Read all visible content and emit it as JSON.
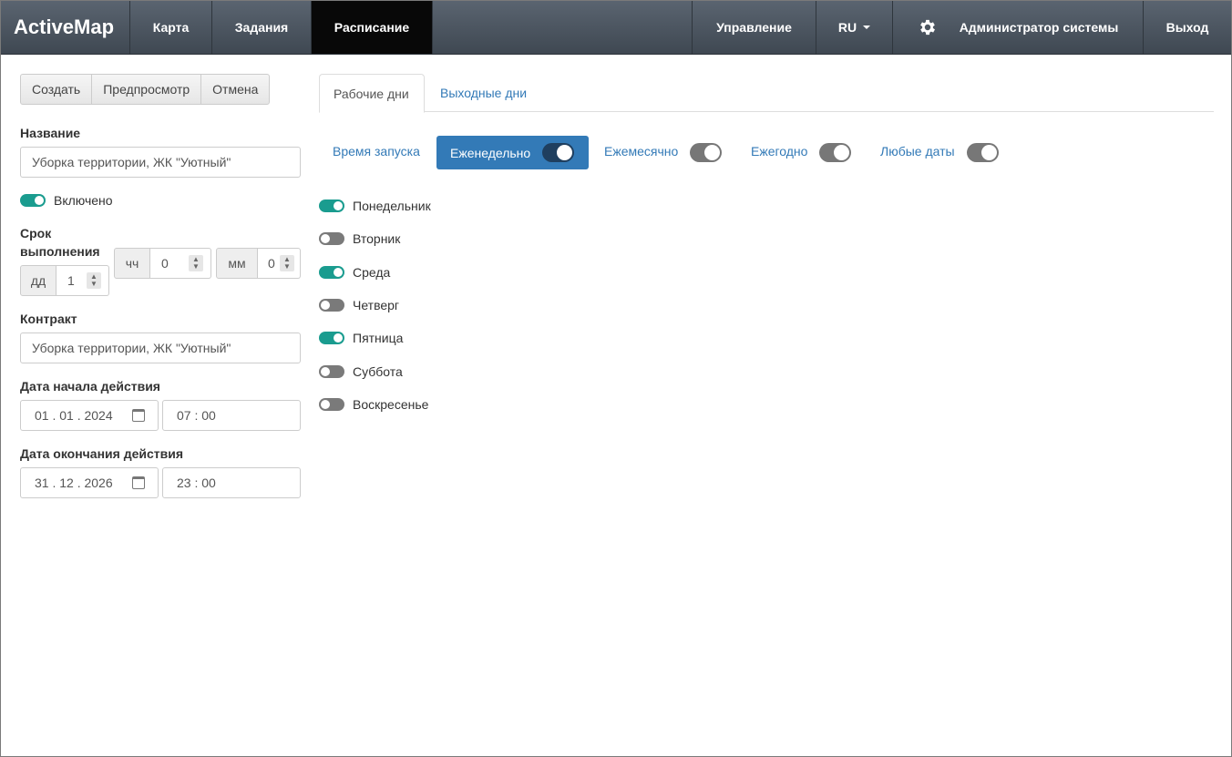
{
  "navbar": {
    "brand": "ActiveMap",
    "items": [
      "Карта",
      "Задания",
      "Расписание"
    ],
    "active": "Расписание",
    "manage": "Управление",
    "lang": "RU",
    "user": "Администратор системы",
    "logout": "Выход"
  },
  "toolbar": {
    "create": "Создать",
    "preview": "Предпросмотр",
    "cancel": "Отмена"
  },
  "form": {
    "name_label": "Название",
    "name_value": "Уборка территории, ЖК \"Уютный\"",
    "enabled_label": "Включено",
    "enabled": true,
    "duration_label_1": "Срок",
    "duration_label_2": "выполнения",
    "days_addon": "дд",
    "days_value": "1",
    "hours_addon": "чч",
    "hours_value": "0",
    "minutes_addon": "мм",
    "minutes_value": "0",
    "contract_label": "Контракт",
    "contract_value": "Уборка территории, ЖК \"Уютный\"",
    "start_label": "Дата начала действия",
    "start_date": "01 . 01 . 2024",
    "start_time": "07 : 00",
    "end_label": "Дата окончания действия",
    "end_date": "31 . 12 . 2026",
    "end_time": "23 : 00"
  },
  "tabs": {
    "workdays": "Рабочие дни",
    "weekends": "Выходные дни"
  },
  "schedule": {
    "launch_time": "Время запуска",
    "weekly": "Еженедельно",
    "monthly": "Ежемесячно",
    "yearly": "Ежегодно",
    "any_dates": "Любые даты"
  },
  "days": [
    {
      "name": "Понедельник",
      "on": true
    },
    {
      "name": "Вторник",
      "on": false
    },
    {
      "name": "Среда",
      "on": true
    },
    {
      "name": "Четверг",
      "on": false
    },
    {
      "name": "Пятница",
      "on": true
    },
    {
      "name": "Суббота",
      "on": false
    },
    {
      "name": "Воскресенье",
      "on": false
    }
  ],
  "colors": {
    "accent": "#337ab7",
    "toggle_on": "#1a9c8f",
    "toggle_off": "#7a7a7a",
    "nav_active": "#080808"
  }
}
